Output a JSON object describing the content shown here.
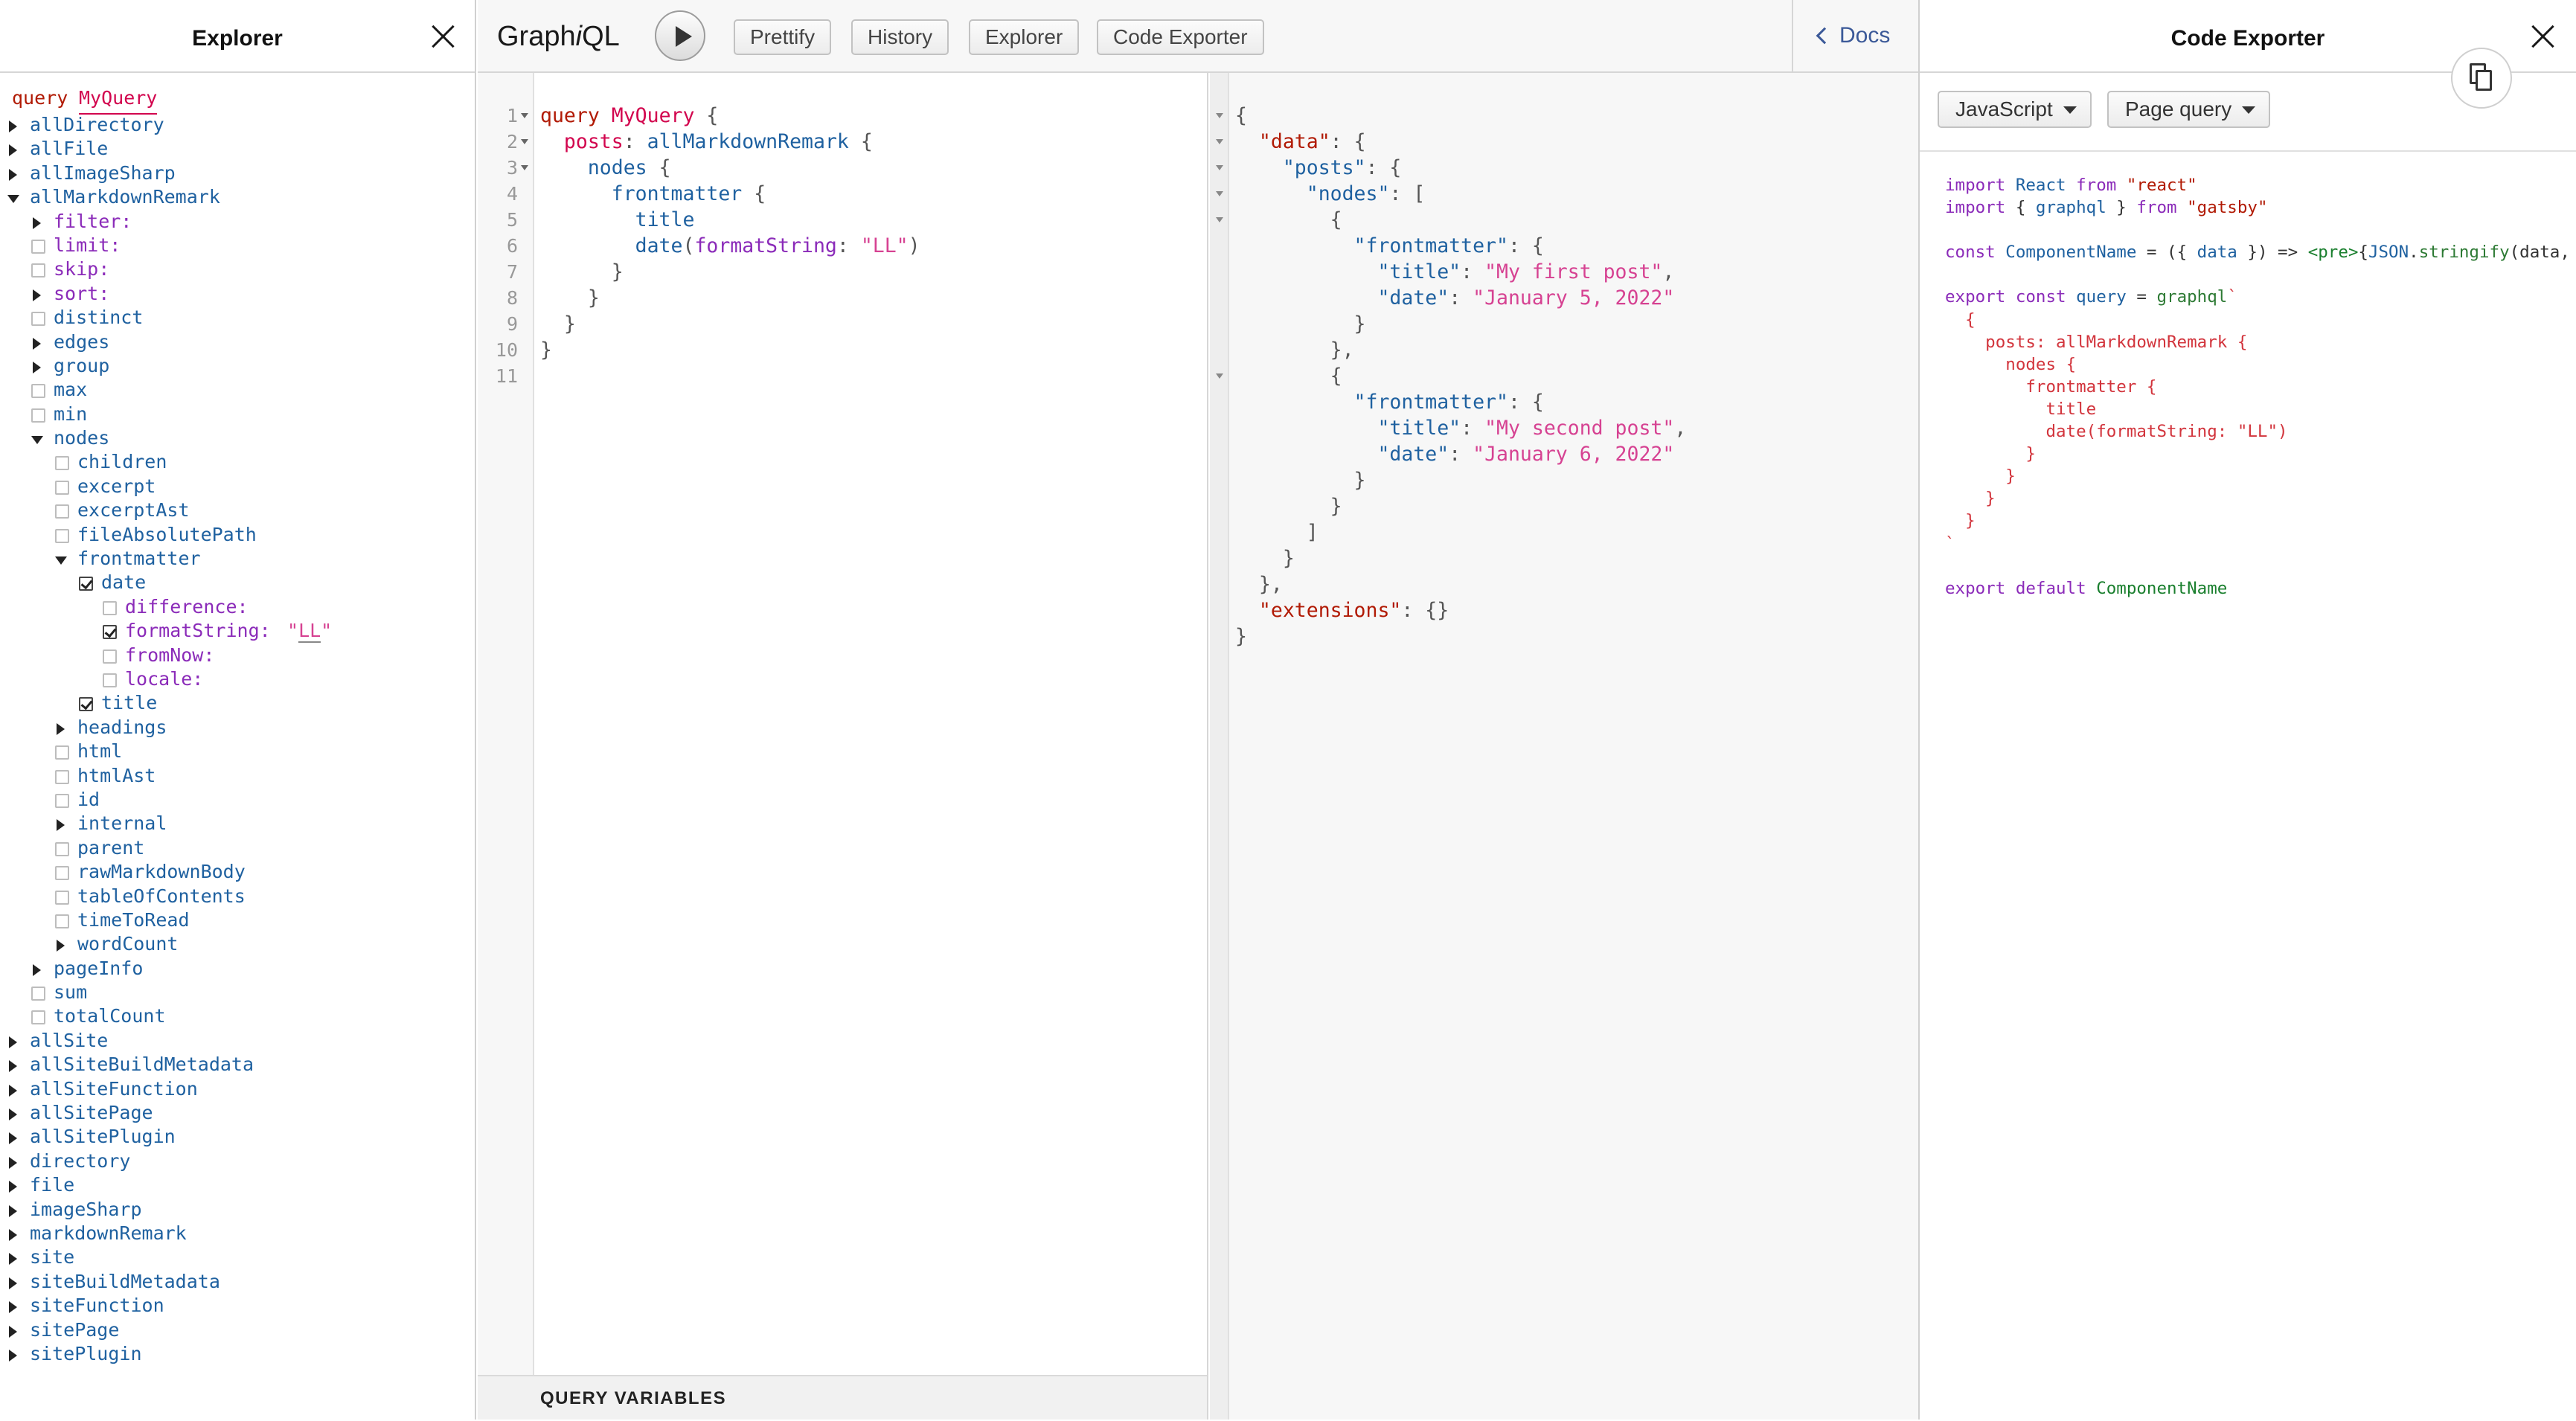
{
  "explorer": {
    "title": "Explorer",
    "operation_keyword": "query",
    "operation_name": "MyQuery",
    "tree": [
      {
        "label": "allDirectory",
        "kind": "field",
        "depth": 0,
        "control": "arrow-right"
      },
      {
        "label": "allFile",
        "kind": "field",
        "depth": 0,
        "control": "arrow-right"
      },
      {
        "label": "allImageSharp",
        "kind": "field",
        "depth": 0,
        "control": "arrow-right"
      },
      {
        "label": "allMarkdownRemark",
        "kind": "field",
        "depth": 0,
        "control": "arrow-down"
      },
      {
        "label": "filter:",
        "kind": "arg",
        "depth": 1,
        "control": "arrow-right"
      },
      {
        "label": "limit:",
        "kind": "arg",
        "depth": 1,
        "control": "checkbox"
      },
      {
        "label": "skip:",
        "kind": "arg",
        "depth": 1,
        "control": "checkbox"
      },
      {
        "label": "sort:",
        "kind": "arg",
        "depth": 1,
        "control": "arrow-right"
      },
      {
        "label": "distinct",
        "kind": "field",
        "depth": 1,
        "control": "checkbox"
      },
      {
        "label": "edges",
        "kind": "field",
        "depth": 1,
        "control": "arrow-right"
      },
      {
        "label": "group",
        "kind": "field",
        "depth": 1,
        "control": "arrow-right"
      },
      {
        "label": "max",
        "kind": "field",
        "depth": 1,
        "control": "checkbox"
      },
      {
        "label": "min",
        "kind": "field",
        "depth": 1,
        "control": "checkbox"
      },
      {
        "label": "nodes",
        "kind": "field",
        "depth": 1,
        "control": "arrow-down"
      },
      {
        "label": "children",
        "kind": "field",
        "depth": 2,
        "control": "checkbox"
      },
      {
        "label": "excerpt",
        "kind": "field",
        "depth": 2,
        "control": "checkbox"
      },
      {
        "label": "excerptAst",
        "kind": "field",
        "depth": 2,
        "control": "checkbox"
      },
      {
        "label": "fileAbsolutePath",
        "kind": "field",
        "depth": 2,
        "control": "checkbox"
      },
      {
        "label": "frontmatter",
        "kind": "field",
        "depth": 2,
        "control": "arrow-down"
      },
      {
        "label": "date",
        "kind": "field",
        "depth": 3,
        "control": "checkbox-on"
      },
      {
        "label": "difference:",
        "kind": "arg",
        "depth": 4,
        "control": "checkbox"
      },
      {
        "label": "formatString:",
        "kind": "arg",
        "depth": 4,
        "control": "checkbox-on",
        "value_open": "\"",
        "value": "LL",
        "value_close": "\""
      },
      {
        "label": "fromNow:",
        "kind": "arg",
        "depth": 4,
        "control": "checkbox"
      },
      {
        "label": "locale:",
        "kind": "arg",
        "depth": 4,
        "control": "checkbox"
      },
      {
        "label": "title",
        "kind": "field",
        "depth": 3,
        "control": "checkbox-on"
      },
      {
        "label": "headings",
        "kind": "field",
        "depth": 2,
        "control": "arrow-right"
      },
      {
        "label": "html",
        "kind": "field",
        "depth": 2,
        "control": "checkbox"
      },
      {
        "label": "htmlAst",
        "kind": "field",
        "depth": 2,
        "control": "checkbox"
      },
      {
        "label": "id",
        "kind": "field",
        "depth": 2,
        "control": "checkbox"
      },
      {
        "label": "internal",
        "kind": "field",
        "depth": 2,
        "control": "arrow-right"
      },
      {
        "label": "parent",
        "kind": "field",
        "depth": 2,
        "control": "checkbox"
      },
      {
        "label": "rawMarkdownBody",
        "kind": "field",
        "depth": 2,
        "control": "checkbox"
      },
      {
        "label": "tableOfContents",
        "kind": "field",
        "depth": 2,
        "control": "checkbox"
      },
      {
        "label": "timeToRead",
        "kind": "field",
        "depth": 2,
        "control": "checkbox"
      },
      {
        "label": "wordCount",
        "kind": "field",
        "depth": 2,
        "control": "arrow-right"
      },
      {
        "label": "pageInfo",
        "kind": "field",
        "depth": 1,
        "control": "arrow-right"
      },
      {
        "label": "sum",
        "kind": "field",
        "depth": 1,
        "control": "checkbox"
      },
      {
        "label": "totalCount",
        "kind": "field",
        "depth": 1,
        "control": "checkbox"
      },
      {
        "label": "allSite",
        "kind": "field",
        "depth": 0,
        "control": "arrow-right"
      },
      {
        "label": "allSiteBuildMetadata",
        "kind": "field",
        "depth": 0,
        "control": "arrow-right"
      },
      {
        "label": "allSiteFunction",
        "kind": "field",
        "depth": 0,
        "control": "arrow-right"
      },
      {
        "label": "allSitePage",
        "kind": "field",
        "depth": 0,
        "control": "arrow-right"
      },
      {
        "label": "allSitePlugin",
        "kind": "field",
        "depth": 0,
        "control": "arrow-right"
      },
      {
        "label": "directory",
        "kind": "field",
        "depth": 0,
        "control": "arrow-right"
      },
      {
        "label": "file",
        "kind": "field",
        "depth": 0,
        "control": "arrow-right"
      },
      {
        "label": "imageSharp",
        "kind": "field",
        "depth": 0,
        "control": "arrow-right"
      },
      {
        "label": "markdownRemark",
        "kind": "field",
        "depth": 0,
        "control": "arrow-right"
      },
      {
        "label": "site",
        "kind": "field",
        "depth": 0,
        "control": "arrow-right"
      },
      {
        "label": "siteBuildMetadata",
        "kind": "field",
        "depth": 0,
        "control": "arrow-right"
      },
      {
        "label": "siteFunction",
        "kind": "field",
        "depth": 0,
        "control": "arrow-right"
      },
      {
        "label": "sitePage",
        "kind": "field",
        "depth": 0,
        "control": "arrow-right"
      },
      {
        "label": "sitePlugin",
        "kind": "field",
        "depth": 0,
        "control": "arrow-right"
      }
    ]
  },
  "toolbar": {
    "logo_pre": "Graph",
    "logo_i": "i",
    "logo_post": "QL",
    "prettify": "Prettify",
    "history": "History",
    "explorer": "Explorer",
    "code_exporter": "Code Exporter",
    "docs": "Docs"
  },
  "editor": {
    "line_numbers": [
      "1",
      "2",
      "3",
      "4",
      "5",
      "6",
      "7",
      "8",
      "9",
      "10",
      "11"
    ],
    "fold_lines": [
      1,
      2,
      3
    ],
    "lines": [
      [
        {
          "t": "query",
          "c": "kw"
        },
        {
          "t": " "
        },
        {
          "t": "MyQuery",
          "c": "def"
        },
        {
          "t": " {",
          "c": "p"
        }
      ],
      [
        {
          "t": "  "
        },
        {
          "t": "posts",
          "c": "def"
        },
        {
          "t": ": ",
          "c": "p"
        },
        {
          "t": "allMarkdownRemark",
          "c": "field"
        },
        {
          "t": " {",
          "c": "p"
        }
      ],
      [
        {
          "t": "    "
        },
        {
          "t": "nodes",
          "c": "field"
        },
        {
          "t": " {",
          "c": "p"
        }
      ],
      [
        {
          "t": "      "
        },
        {
          "t": "frontmatter",
          "c": "field"
        },
        {
          "t": " {",
          "c": "p"
        }
      ],
      [
        {
          "t": "        "
        },
        {
          "t": "title",
          "c": "field"
        }
      ],
      [
        {
          "t": "        "
        },
        {
          "t": "date",
          "c": "field"
        },
        {
          "t": "(",
          "c": "p"
        },
        {
          "t": "formatString",
          "c": "arg"
        },
        {
          "t": ": ",
          "c": "p"
        },
        {
          "t": "\"LL\"",
          "c": "str"
        },
        {
          "t": ")",
          "c": "p"
        }
      ],
      [
        {
          "t": "      "
        },
        {
          "t": "}",
          "c": "p"
        }
      ],
      [
        {
          "t": "    "
        },
        {
          "t": "}",
          "c": "p"
        }
      ],
      [
        {
          "t": "  "
        },
        {
          "t": "}",
          "c": "p"
        }
      ],
      [
        {
          "t": "}",
          "c": "p"
        }
      ],
      []
    ],
    "query_variables_label": "QUERY VARIABLES"
  },
  "result": {
    "fold_lines": [
      1,
      2,
      3,
      4,
      5,
      11
    ],
    "lines": [
      [
        {
          "t": "{",
          "c": "p"
        }
      ],
      [
        {
          "t": "  "
        },
        {
          "t": "\"data\"",
          "c": "key"
        },
        {
          "t": ": {",
          "c": "p"
        }
      ],
      [
        {
          "t": "    "
        },
        {
          "t": "\"posts\"",
          "c": "field"
        },
        {
          "t": ": {",
          "c": "p"
        }
      ],
      [
        {
          "t": "      "
        },
        {
          "t": "\"nodes\"",
          "c": "field"
        },
        {
          "t": ": [",
          "c": "p"
        }
      ],
      [
        {
          "t": "        "
        },
        {
          "t": "{",
          "c": "p"
        }
      ],
      [
        {
          "t": "          "
        },
        {
          "t": "\"frontmatter\"",
          "c": "field"
        },
        {
          "t": ": {",
          "c": "p"
        }
      ],
      [
        {
          "t": "            "
        },
        {
          "t": "\"title\"",
          "c": "field"
        },
        {
          "t": ": ",
          "c": "p"
        },
        {
          "t": "\"My first post\"",
          "c": "str"
        },
        {
          "t": ",",
          "c": "p"
        }
      ],
      [
        {
          "t": "            "
        },
        {
          "t": "\"date\"",
          "c": "field"
        },
        {
          "t": ": ",
          "c": "p"
        },
        {
          "t": "\"January 5, 2022\"",
          "c": "str"
        }
      ],
      [
        {
          "t": "          "
        },
        {
          "t": "}",
          "c": "p"
        }
      ],
      [
        {
          "t": "        "
        },
        {
          "t": "},",
          "c": "p"
        }
      ],
      [
        {
          "t": "        "
        },
        {
          "t": "{",
          "c": "p"
        }
      ],
      [
        {
          "t": "          "
        },
        {
          "t": "\"frontmatter\"",
          "c": "field"
        },
        {
          "t": ": {",
          "c": "p"
        }
      ],
      [
        {
          "t": "            "
        },
        {
          "t": "\"title\"",
          "c": "field"
        },
        {
          "t": ": ",
          "c": "p"
        },
        {
          "t": "\"My second post\"",
          "c": "str"
        },
        {
          "t": ",",
          "c": "p"
        }
      ],
      [
        {
          "t": "            "
        },
        {
          "t": "\"date\"",
          "c": "field"
        },
        {
          "t": ": ",
          "c": "p"
        },
        {
          "t": "\"January 6, 2022\"",
          "c": "str"
        }
      ],
      [
        {
          "t": "          "
        },
        {
          "t": "}",
          "c": "p"
        }
      ],
      [
        {
          "t": "        "
        },
        {
          "t": "}",
          "c": "p"
        }
      ],
      [
        {
          "t": "      "
        },
        {
          "t": "]",
          "c": "p"
        }
      ],
      [
        {
          "t": "    "
        },
        {
          "t": "}",
          "c": "p"
        }
      ],
      [
        {
          "t": "  "
        },
        {
          "t": "},",
          "c": "p"
        }
      ],
      [
        {
          "t": "  "
        },
        {
          "t": "\"extensions\"",
          "c": "key"
        },
        {
          "t": ": {}",
          "c": "p"
        }
      ],
      [
        {
          "t": "}",
          "c": "p"
        }
      ]
    ]
  },
  "exporter": {
    "title": "Code Exporter",
    "language": "JavaScript",
    "mode": "Page query",
    "lines": [
      [
        {
          "t": "import",
          "c": "kw"
        },
        {
          "t": " "
        },
        {
          "t": "React",
          "c": "def"
        },
        {
          "t": " "
        },
        {
          "t": "from",
          "c": "kw"
        },
        {
          "t": " "
        },
        {
          "t": "\"react\"",
          "c": "str"
        }
      ],
      [
        {
          "t": "import",
          "c": "kw"
        },
        {
          "t": " { "
        },
        {
          "t": "graphql",
          "c": "def"
        },
        {
          "t": " } "
        },
        {
          "t": "from",
          "c": "kw"
        },
        {
          "t": " "
        },
        {
          "t": "\"gatsby\"",
          "c": "str"
        }
      ],
      [],
      [
        {
          "t": "const",
          "c": "kw"
        },
        {
          "t": " "
        },
        {
          "t": "ComponentName",
          "c": "def"
        },
        {
          "t": " = ({ "
        },
        {
          "t": "data",
          "c": "def"
        },
        {
          "t": " }) => "
        },
        {
          "t": "<pre>",
          "c": "tag"
        },
        {
          "t": "{"
        },
        {
          "t": "JSON",
          "c": "def"
        },
        {
          "t": "."
        },
        {
          "t": "stringify",
          "c": "fn"
        },
        {
          "t": "(data,"
        }
      ],
      [],
      [
        {
          "t": "export",
          "c": "kw"
        },
        {
          "t": " "
        },
        {
          "t": "const",
          "c": "kw"
        },
        {
          "t": " "
        },
        {
          "t": "query",
          "c": "def"
        },
        {
          "t": " = "
        },
        {
          "t": "graphql",
          "c": "fn"
        },
        {
          "t": "`",
          "c": "gql"
        }
      ],
      [
        {
          "t": "  {",
          "c": "gql"
        }
      ],
      [
        {
          "t": "    posts: allMarkdownRemark {",
          "c": "gql"
        }
      ],
      [
        {
          "t": "      nodes {",
          "c": "gql"
        }
      ],
      [
        {
          "t": "        frontmatter {",
          "c": "gql"
        }
      ],
      [
        {
          "t": "          title",
          "c": "gql"
        }
      ],
      [
        {
          "t": "          date(formatString: \"LL\")",
          "c": "gql"
        }
      ],
      [
        {
          "t": "        }",
          "c": "gql"
        }
      ],
      [
        {
          "t": "      }",
          "c": "gql"
        }
      ],
      [
        {
          "t": "    }",
          "c": "gql"
        }
      ],
      [
        {
          "t": "  }",
          "c": "gql"
        }
      ],
      [
        {
          "t": "`",
          "c": "gql"
        }
      ],
      [],
      [
        {
          "t": "export",
          "c": "kw"
        },
        {
          "t": " "
        },
        {
          "t": "default",
          "c": "kw"
        },
        {
          "t": " "
        },
        {
          "t": "ComponentName",
          "c": "tag"
        }
      ]
    ]
  }
}
